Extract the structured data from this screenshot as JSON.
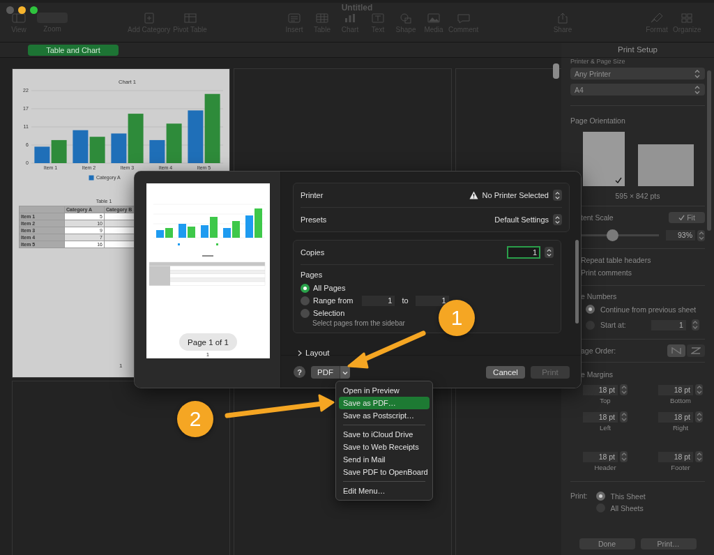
{
  "window": {
    "title": "Untitled"
  },
  "toolbar": {
    "groups": [
      {
        "items": [
          {
            "kind": "button",
            "label": "View"
          },
          {
            "kind": "popup",
            "label": "Zoom"
          }
        ]
      },
      {
        "items": [
          {
            "kind": "button",
            "label": "Add Category"
          },
          {
            "kind": "button",
            "label": "Pivot Table"
          }
        ]
      },
      {
        "items": [
          {
            "kind": "button",
            "label": "Insert"
          },
          {
            "kind": "button",
            "label": "Table"
          },
          {
            "kind": "button",
            "label": "Chart"
          },
          {
            "kind": "button",
            "label": "Text"
          },
          {
            "kind": "button",
            "label": "Shape"
          },
          {
            "kind": "button",
            "label": "Media"
          },
          {
            "kind": "button",
            "label": "Comment"
          }
        ]
      },
      {
        "items": [
          {
            "kind": "button",
            "label": "Share"
          }
        ]
      },
      {
        "items": [
          {
            "kind": "button",
            "label": "Format"
          },
          {
            "kind": "button",
            "label": "Organize"
          }
        ]
      }
    ]
  },
  "sheet": {
    "tabs": [
      {
        "label": "Table and Chart",
        "selected": true
      }
    ],
    "page": {
      "chart": {
        "chart_data": {
          "type": "bar",
          "title": "Chart 1",
          "categories": [
            "Item 1",
            "Item 2",
            "Item 3",
            "Item 4",
            "Item 5"
          ],
          "series": [
            {
              "name": "Category A",
              "color": "#1f6fb8",
              "values": [
                5,
                10,
                9,
                7,
                16
              ]
            },
            {
              "color": "#2e8b3a",
              "values": [
                7,
                8,
                15,
                12,
                21
              ]
            }
          ],
          "ylim": [
            0,
            22
          ],
          "yticks": [
            0,
            {
              "value": 5.5,
              "label": "6"
            },
            11,
            {
              "value": 16.5,
              "label": "17"
            },
            22
          ],
          "grid": true,
          "legend": true
        }
      },
      "table": {
        "title": "Table 1",
        "columns": [
          "",
          "Category A",
          "Category B"
        ],
        "rows": [
          {
            "cells": [
              "Item 1",
              "5"
            ]
          },
          {
            "cells": [
              "Item 2",
              "10"
            ]
          },
          {
            "cells": [
              "Item 3",
              "9"
            ]
          },
          {
            "cells": [
              "Item 4",
              "7"
            ]
          },
          {
            "cells": [
              "Item 5",
              "16"
            ]
          }
        ]
      },
      "page_number": "1"
    }
  },
  "sidebar": {
    "title": "Print Setup",
    "section_title": "Printer & Page Size",
    "printer_popup": "Any Printer",
    "paper_popup": "A4",
    "orientation": {
      "label": "Page Orientation",
      "options": [
        {
          "kind": "portrait",
          "selected": true
        },
        {
          "kind": "landscape",
          "selected": false
        }
      ],
      "size": "595 × 842 pts"
    },
    "scale": {
      "label": "tent Scale",
      "fit": {
        "label": "Fit",
        "checked": true
      },
      "level": 0.4,
      "value": "93%"
    },
    "checkboxes": [
      {
        "label": "Repeat table headers"
      },
      {
        "label": "Print comments"
      }
    ],
    "page_numbers": {
      "label": "e Numbers",
      "options": [
        {
          "label": "Continue from previous sheet",
          "selected": true
        },
        {
          "label": "Start at:",
          "selected": false
        }
      ],
      "start_value": "1"
    },
    "page_order": {
      "label": "age Order:",
      "options": [
        {
          "selected": true
        },
        {
          "selected": false
        }
      ]
    },
    "margins": {
      "label": "e Margins",
      "fields": [
        {
          "value": "18 pt",
          "label": "Top"
        },
        {
          "value": "18 pt",
          "label": "Bottom"
        },
        {
          "value": "18 pt",
          "label": "Left"
        },
        {
          "value": "18 pt",
          "label": "Right"
        },
        {
          "value": "18 pt",
          "label": "Header"
        },
        {
          "value": "18 pt",
          "label": "Footer"
        }
      ]
    },
    "print": {
      "label": "Print:",
      "options": [
        {
          "label": "This Sheet",
          "selected": true
        },
        {
          "label": "All Sheets",
          "selected": false
        }
      ]
    },
    "buttons": [
      "Done",
      "Print…"
    ]
  },
  "print_dialog": {
    "preview": {
      "page_indicator": "Page 1 of 1",
      "page_number": "1"
    },
    "printer": {
      "label": "Printer",
      "value": "No Printer Selected",
      "warning": true
    },
    "presets": {
      "label": "Presets",
      "value": "Default Settings"
    },
    "copies": {
      "label": "Copies",
      "value": "1",
      "focused": true
    },
    "pages": {
      "label": "Pages",
      "options": [
        {
          "kind": "all",
          "label": "All Pages",
          "selected": true
        },
        {
          "kind": "range",
          "label": "Range from",
          "selected": false,
          "from": "1",
          "to_label": "to",
          "to": "1"
        },
        {
          "kind": "selection",
          "label": "Selection",
          "selected": false,
          "hint": "Select pages from the sidebar"
        }
      ]
    },
    "layout": {
      "label": "Layout",
      "expanded": false
    },
    "help_button": "?",
    "pdf_button": "PDF",
    "cancel_button": "Cancel",
    "print_button": {
      "label": "Print",
      "disabled": true
    }
  },
  "pdf_menu": {
    "items": [
      {
        "kind": "item",
        "label": "Open in Preview",
        "selected": false
      },
      {
        "kind": "item",
        "label": "Save as PDF…",
        "selected": true
      },
      {
        "kind": "item",
        "label": "Save as Postscript…",
        "selected": false
      },
      {
        "kind": "separator"
      },
      {
        "kind": "item",
        "label": "Save to iCloud Drive",
        "selected": false
      },
      {
        "kind": "item",
        "label": "Save to Web Receipts",
        "selected": false
      },
      {
        "kind": "item",
        "label": "Send in Mail",
        "selected": false
      },
      {
        "kind": "item",
        "label": "Save PDF to OpenBoard",
        "selected": false
      },
      {
        "kind": "separator"
      },
      {
        "kind": "item",
        "label": "Edit Menu…",
        "selected": false
      }
    ]
  },
  "annotations": [
    {
      "label": "1"
    },
    {
      "label": "2"
    }
  ]
}
